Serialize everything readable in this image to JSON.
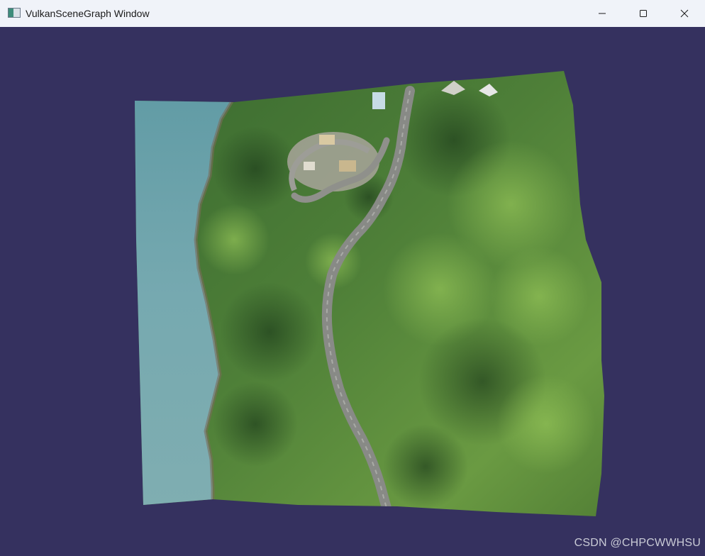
{
  "window": {
    "title": "VulkanSceneGraph Window",
    "icon": "app-window-icon",
    "controls": {
      "minimize_icon": "minimize-icon",
      "maximize_icon": "maximize-icon",
      "close_icon": "close-icon"
    }
  },
  "viewport": {
    "background_color": "#35315f",
    "terrain_colors": {
      "sea": "#6fa3ab",
      "forest_dark": "#2f5a2a",
      "forest_mid": "#4f7d37",
      "forest_light": "#7aa64a",
      "road": "#8f918d"
    }
  },
  "watermark": {
    "text": "CSDN @CHPCWWHSU"
  }
}
